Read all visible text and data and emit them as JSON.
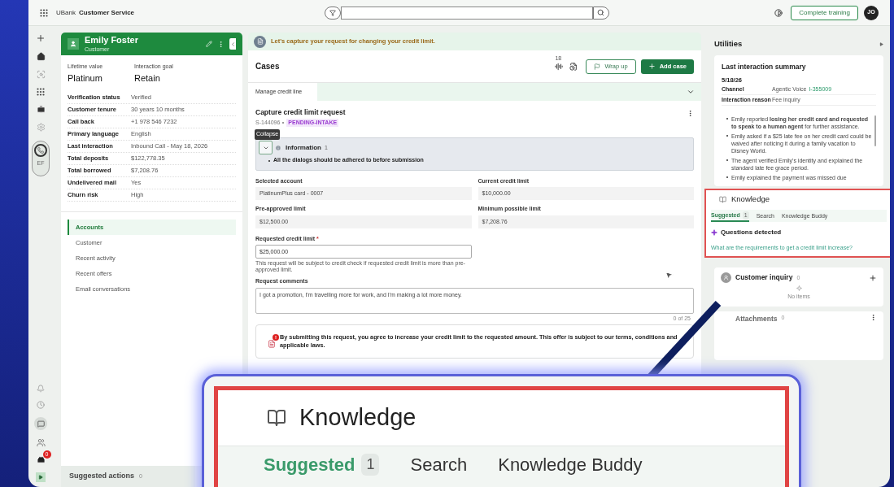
{
  "app_bar": {
    "brand": "UBank",
    "title": "Customer Service",
    "training_button": "Complete training",
    "avatar": "JO"
  },
  "nav_rail": {
    "call_badge": "EF",
    "inbox_badge": "0"
  },
  "customer": {
    "name": "Emily Foster",
    "role": "Customer",
    "highlights": [
      {
        "label": "Lifetime value",
        "value": "Platinum"
      },
      {
        "label": "Interaction goal",
        "value": "Retain"
      }
    ],
    "fields": [
      {
        "label": "Verification status",
        "value": "Verified"
      },
      {
        "label": "Customer tenure",
        "value": "30 years 10 months"
      },
      {
        "label": "Call back",
        "value": "+1 978 546 7232"
      },
      {
        "label": "Primary language",
        "value": "English"
      },
      {
        "label": "Last interaction",
        "value": "Inbound Call - May 18, 2026"
      },
      {
        "label": "Total deposits",
        "value": "$122,778.35"
      },
      {
        "label": "Total borrowed",
        "value": "$7,208.76"
      },
      {
        "label": "Undelivered mail",
        "value": "Yes"
      },
      {
        "label": "Churn risk",
        "value": "High"
      }
    ],
    "sections": [
      {
        "label": "Accounts",
        "selected": true
      },
      {
        "label": "Customer",
        "selected": false
      },
      {
        "label": "Recent activity",
        "selected": false
      },
      {
        "label": "Recent offers",
        "selected": false
      },
      {
        "label": "Email conversations",
        "selected": false
      }
    ]
  },
  "suggested_actions": {
    "label": "Suggested actions",
    "count": "0"
  },
  "banner": "Let's capture your request for changing your credit limit.",
  "cases": {
    "title": "Cases",
    "count": "18",
    "wrap_up": "Wrap up",
    "add_case": "Add case",
    "tabs": [
      {
        "label": "Manage credit line",
        "selected": true
      }
    ],
    "case": {
      "title": "Capture credit limit request",
      "id": "S-144096",
      "status": "PENDING-INTAKE",
      "tooltip": "Collapse",
      "info": {
        "title": "Information",
        "count": "1",
        "expanded": true,
        "items": [
          "All the dialogs should be adhered to before submission"
        ]
      },
      "fields": [
        {
          "label": "Selected account",
          "value": "PlatinumPlus card - 0007"
        },
        {
          "label": "Current credit limit",
          "value": "$10,000.00"
        },
        {
          "label": "Pre-approved limit",
          "value": "$12,500.00"
        },
        {
          "label": "Minimum possible limit",
          "value": "$7,208.76"
        }
      ],
      "requested": {
        "label": "Requested credit limit",
        "required_mark": "*",
        "value": "$25,000.00",
        "hint": "This request will be subject to credit check if requested credit limit is more than pre-approved limit."
      },
      "comments": {
        "label": "Request comments",
        "value": "I got a promotion, I'm travelling more for work, and I'm making a lot more money.",
        "counter": "0 of 25"
      },
      "notice": {
        "badge": "!",
        "text": "By submitting this request, you agree to increase your credit limit to the requested amount. This offer is subject to our terms, conditions and applicable laws."
      }
    }
  },
  "utilities": {
    "title": "Utilities",
    "summary": {
      "title": "Last interaction summary",
      "date": "5/18/26",
      "rows": [
        {
          "label": "Channel",
          "value": "Agentic Voice",
          "link": "I-355009"
        },
        {
          "label": "Interaction reason",
          "value": "Fee inquiry"
        }
      ],
      "bullets": [
        "Emily reported **losing her credit card and requested to speak to a human agent** for further assistance.",
        "Emily asked if a $25 late fee on her credit card could be waived after noticing it during a family vacation to Disney World.",
        "The agent verified Emily's identity and explained the standard late fee grace period.",
        "Emily explained the payment was missed due"
      ]
    },
    "knowledge": {
      "title": "Knowledge",
      "tabs": [
        {
          "label": "Suggested",
          "count": "1",
          "selected": true
        },
        {
          "label": "Search",
          "selected": false
        },
        {
          "label": "Knowledge Buddy",
          "selected": false
        }
      ],
      "questions_title": "Questions detected",
      "question": "What are the requirements to get a credit limit increase?"
    },
    "inquiry": {
      "title": "Customer inquiry",
      "count": "0",
      "empty": "No items"
    },
    "attachments": {
      "title": "Attachments",
      "count": "0"
    }
  },
  "zoom_inset": {
    "title": "Knowledge",
    "tabs": [
      {
        "label": "Suggested",
        "count": "1",
        "selected": true
      },
      {
        "label": "Search",
        "selected": false
      },
      {
        "label": "Knowledge Buddy",
        "selected": false
      }
    ]
  }
}
